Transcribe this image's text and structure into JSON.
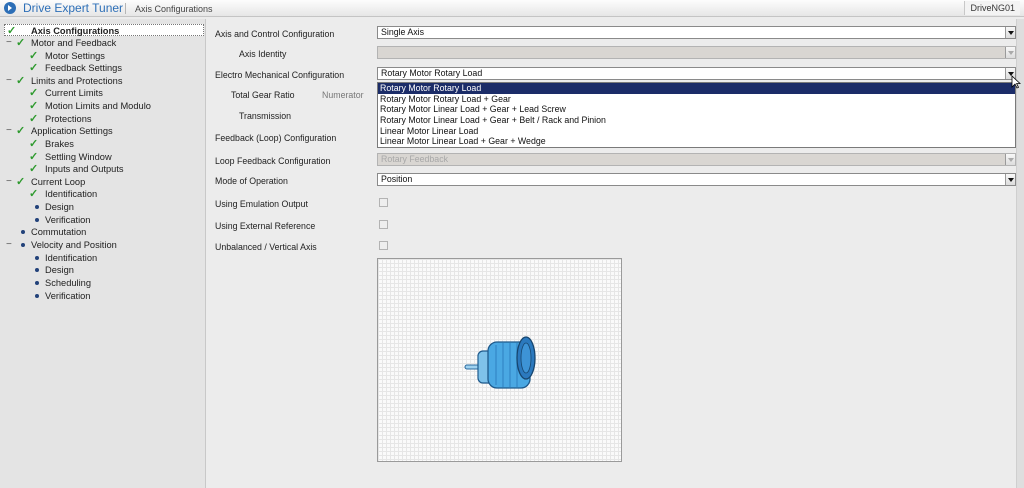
{
  "header": {
    "app_title": "Drive Expert Tuner",
    "breadcrumb": "Axis Configurations",
    "drive_name": "DriveNG01"
  },
  "sidebar": {
    "items": [
      {
        "label": "Axis Configurations",
        "status": "check",
        "bold": true,
        "selected": true
      },
      {
        "label": "Motor and Feedback",
        "status": "check",
        "expanded": true
      },
      {
        "label": "Motor Settings",
        "status": "check"
      },
      {
        "label": "Feedback Settings",
        "status": "check"
      },
      {
        "label": "Limits and Protections",
        "status": "check",
        "expanded": true
      },
      {
        "label": "Current Limits",
        "status": "check"
      },
      {
        "label": "Motion Limits and Modulo",
        "status": "check"
      },
      {
        "label": "Protections",
        "status": "check"
      },
      {
        "label": "Application Settings",
        "status": "check",
        "expanded": true
      },
      {
        "label": "Brakes",
        "status": "check"
      },
      {
        "label": "Settling Window",
        "status": "check"
      },
      {
        "label": "Inputs and Outputs",
        "status": "check"
      },
      {
        "label": "Current Loop",
        "status": "check",
        "expanded": true
      },
      {
        "label": "Identification",
        "status": "check"
      },
      {
        "label": "Design",
        "status": "dot"
      },
      {
        "label": "Verification",
        "status": "dot"
      },
      {
        "label": "Commutation",
        "status": "dot"
      },
      {
        "label": "Velocity and Position",
        "status": "dot",
        "expanded": true
      },
      {
        "label": "Identification",
        "status": "dot"
      },
      {
        "label": "Design",
        "status": "dot"
      },
      {
        "label": "Scheduling",
        "status": "dot"
      },
      {
        "label": "Verification",
        "status": "dot"
      }
    ]
  },
  "form": {
    "axis_control_label": "Axis and Control Configuration",
    "axis_control_value": "Single Axis",
    "axis_identity_label": "Axis Identity",
    "axis_identity_value": "",
    "electro_label": "Electro Mechanical Configuration",
    "electro_value": "Rotary Motor Rotary Load",
    "total_gear_label": "Total Gear Ratio",
    "numerator_label": "Numerator",
    "transmission_label": "Transmission",
    "feedback_loop_label": "Feedback (Loop) Configuration",
    "loop_feedback_label": "Loop Feedback Configuration",
    "loop_feedback_value": "Rotary Feedback",
    "mode_label": "Mode of Operation",
    "mode_value": "Position",
    "emulation_label": "Using Emulation Output",
    "external_ref_label": "Using External Reference",
    "unbalanced_label": "Unbalanced / Vertical Axis"
  },
  "dropdown_options": [
    "Rotary Motor Rotary Load",
    "Rotary Motor Rotary Load + Gear",
    "Rotary Motor Linear Load + Gear + Lead Screw",
    "Rotary Motor Linear Load + Gear + Belt / Rack and Pinion",
    "Linear Motor Linear Load",
    "Linear Motor Linear Load + Gear + Wedge"
  ],
  "colors": {
    "accent": "#2d6fb7",
    "check": "#2e9a2e",
    "selection": "#1b2c68"
  }
}
